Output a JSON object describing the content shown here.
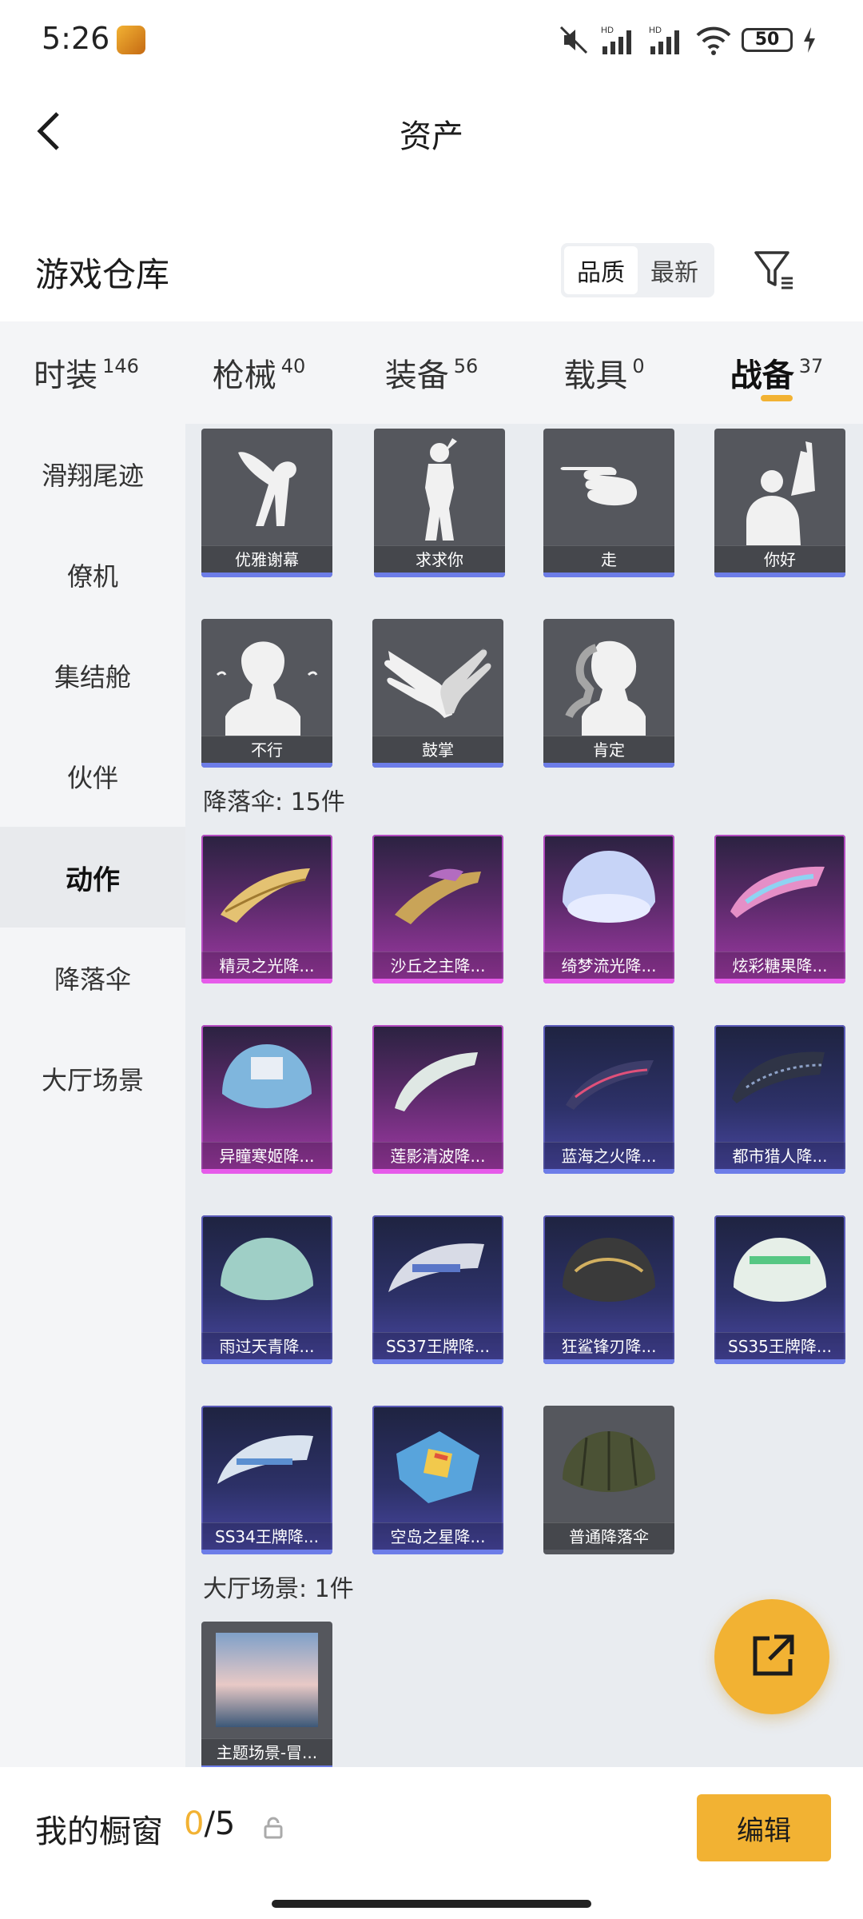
{
  "status": {
    "time": "5:26",
    "battery": "50"
  },
  "header": {
    "title": "资产"
  },
  "warehouse": {
    "title": "游戏仓库",
    "sort_quality": "品质",
    "sort_newest": "最新"
  },
  "tabs": [
    {
      "name": "时装",
      "count": "146"
    },
    {
      "name": "枪械",
      "count": "40"
    },
    {
      "name": "装备",
      "count": "56"
    },
    {
      "name": "载具",
      "count": "0"
    },
    {
      "name": "战备",
      "count": "37"
    }
  ],
  "sidebar": [
    "滑翔尾迹",
    "僚机",
    "集结舱",
    "伙伴",
    "动作",
    "降落伞",
    "大厅场景"
  ],
  "emotes": [
    "优雅谢幕",
    "求求你",
    "走",
    "你好",
    "不行",
    "鼓掌",
    "肯定"
  ],
  "parachute_title": "降落伞: 15件",
  "parachutes": [
    "精灵之光降...",
    "沙丘之主降...",
    "绮梦流光降...",
    "炫彩糖果降...",
    "异瞳寒姬降...",
    "莲影清波降...",
    "蓝海之火降...",
    "都市猎人降...",
    "雨过天青降...",
    "SS37王牌降...",
    "狂鲨锋刃降...",
    "SS35王牌降...",
    "SS34王牌降...",
    "空岛之星降...",
    "普通降落伞"
  ],
  "lobby_title": "大厅场景: 1件",
  "lobby": [
    "主题场景-冒..."
  ],
  "showcase": {
    "label": "我的橱窗",
    "current": "0",
    "total": "/5",
    "edit": "编辑"
  },
  "colors": {
    "accent": "#f2b233",
    "purple_rarity": "#e65bea",
    "blue_rarity": "#6d7de8"
  }
}
